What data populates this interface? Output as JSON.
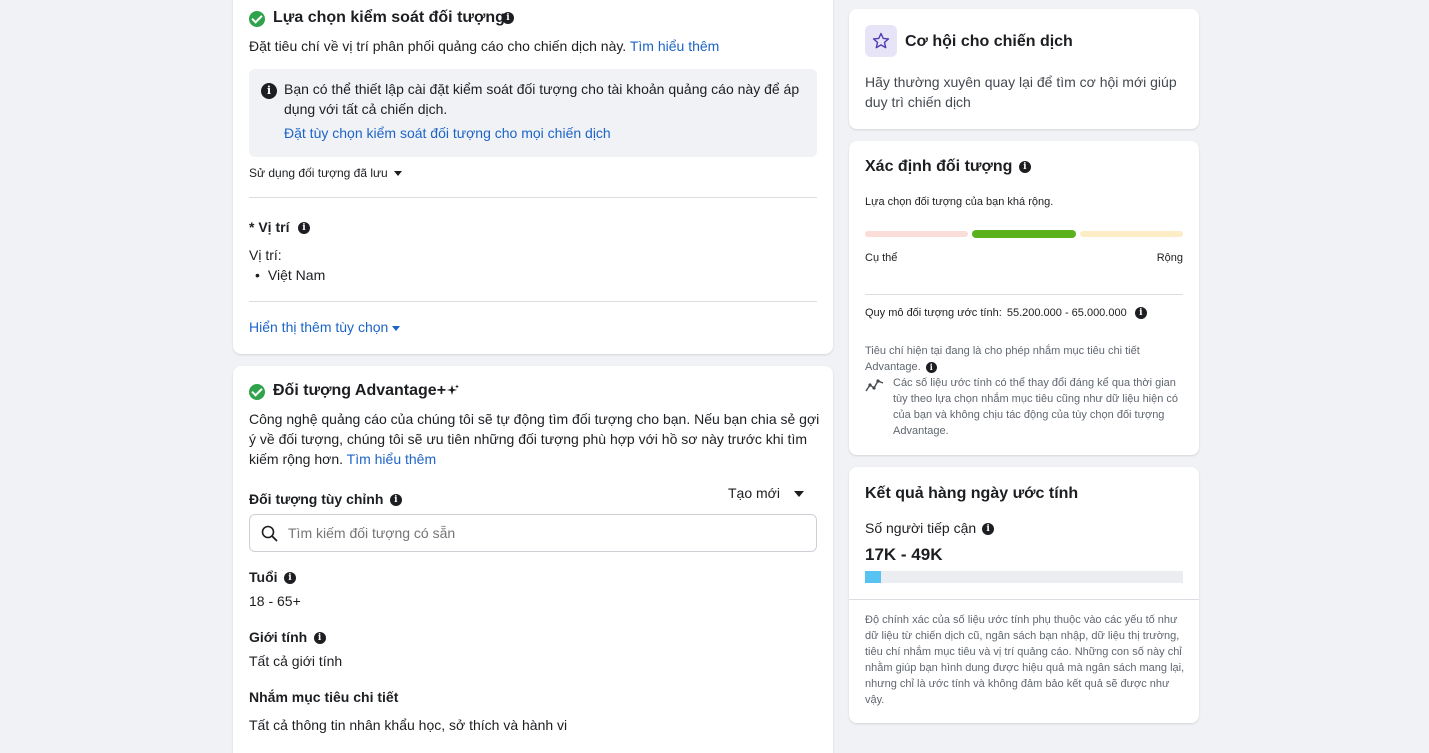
{
  "audience_controls": {
    "title": "Lựa chọn kiểm soát đối tượng",
    "description": "Đặt tiêu chí về vị trí phân phối quảng cáo cho chiến dịch này.",
    "learn_more": "Tìm hiểu thêm",
    "notice_text": "Bạn có thể thiết lập cài đặt kiểm soát đối tượng cho tài khoản quảng cáo này để áp dụng với tất cả chiến dịch.",
    "notice_link": "Đặt tùy chọn kiểm soát đối tượng cho mọi chiến dịch",
    "saved_audience": "Sử dụng đối tượng đã lưu",
    "location_label": "* Vị trí",
    "location_sub": "Vị trí:",
    "location_value": "Việt Nam",
    "more_options": "Hiển thị thêm tùy chọn"
  },
  "advantage": {
    "title": "Đối tượng Advantage+",
    "description": "Công nghệ quảng cáo của chúng tôi sẽ tự động tìm đối tượng cho bạn. Nếu bạn chia sẻ gợi ý về đối tượng, chúng tôi sẽ ưu tiên những đối tượng phù hợp với hồ sơ này trước khi tìm kiếm rộng hơn.",
    "learn_more": "Tìm hiểu thêm",
    "custom_audience_label": "Đối tượng tùy chỉnh",
    "create_new": "Tạo mới",
    "search_placeholder": "Tìm kiếm đối tượng có sẵn",
    "age_label": "Tuổi",
    "age_value": "18 - 65+",
    "gender_label": "Giới tính",
    "gender_value": "Tất cả giới tính",
    "detailed_label": "Nhắm mục tiêu chi tiết",
    "detailed_value": "Tất cả thông tin nhân khẩu học, sở thích và hành vi"
  },
  "opportunity": {
    "title": "Cơ hội cho chiến dịch",
    "text": "Hãy thường xuyên quay lại để tìm cơ hội mới giúp duy trì chiến dịch"
  },
  "definition": {
    "title": "Xác định đối tượng",
    "subtitle": "Lựa chọn đối tượng của bạn khá rộng.",
    "specific": "Cụ thể",
    "broad": "Rộng",
    "size_label": "Quy mô đối tượng ước tính:",
    "size_value": "55.200.000 - 65.000.000",
    "note1": "Tiêu chí hiện tại đang là cho phép nhắm mục tiêu chi tiết Advantage.",
    "note2": "Các số liệu ước tính có thể thay đổi đáng kể qua thời gian tùy theo lựa chọn nhắm mục tiêu cũng như dữ liệu hiện có của bạn và không chịu tác động của tùy chọn đối tượng Advantage."
  },
  "daily_results": {
    "title": "Kết quả hàng ngày ước tính",
    "reach_label": "Số người tiếp cận",
    "reach_value": "17K - 49K",
    "reach_fill_fraction": 0.05,
    "disclaimer": "Độ chính xác của số liệu ước tính phụ thuộc vào các yếu tố như dữ liệu từ chiến dịch cũ, ngân sách bạn nhập, dữ liệu thị trường, tiêu chí nhắm mục tiêu và vị trí quảng cáo. Những con số này chỉ nhằm giúp bạn hình dung được hiệu quả mà ngân sách mang lại, nhưng chỉ là ước tính và không đảm bảo kết quả sẽ được như vậy."
  },
  "colors": {
    "link": "#1d64c8",
    "success": "#31a24c",
    "meter_specific": "#fadcd9",
    "meter_active": "#5ab11d",
    "meter_broad": "#fcedc6",
    "reach_fill": "#56c3f2"
  }
}
